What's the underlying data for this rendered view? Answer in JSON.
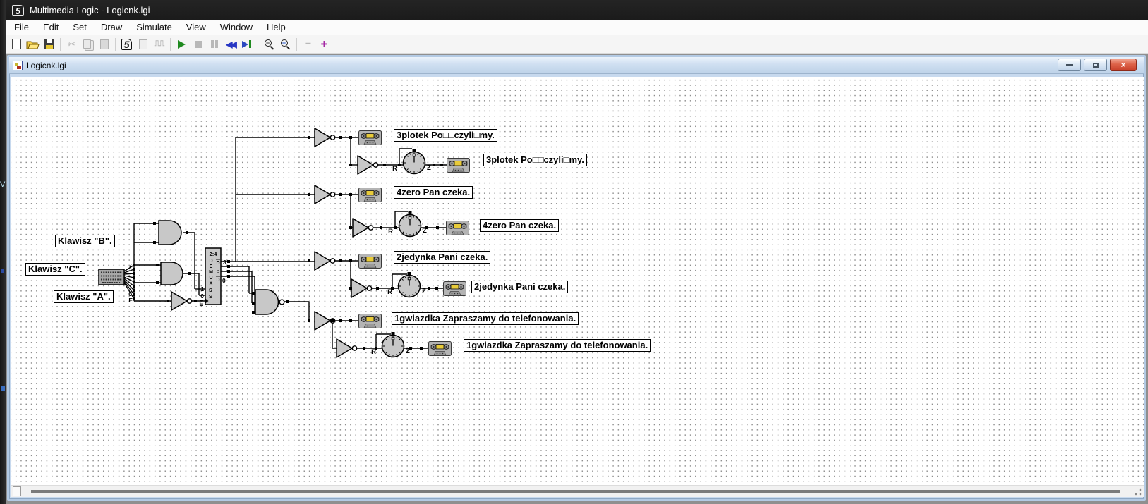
{
  "window": {
    "title": "Multimedia Logic - Logicnk.lgi"
  },
  "menu": {
    "items": [
      "File",
      "Edit",
      "Set",
      "Draw",
      "Simulate",
      "View",
      "Window",
      "Help"
    ]
  },
  "toolbar": {
    "icons": [
      "new",
      "open",
      "save",
      "cut",
      "copy",
      "paste",
      "logo",
      "report",
      "signals",
      "run",
      "stop",
      "pause",
      "rewind",
      "step-end",
      "zoom-out",
      "zoom-in",
      "remove",
      "add"
    ]
  },
  "child_window": {
    "title": "Logicnk.lgi"
  },
  "circuit": {
    "side_labels": [
      "Klawisz \"B\".",
      "Klawisz \"C\".",
      "Klawisz \"A\"."
    ],
    "keyboard_pins": {
      "top": "7",
      "bottom": "0",
      "enable": "E"
    },
    "demux": {
      "ratio": "2:4",
      "letters": [
        "D",
        "E",
        "M",
        "U",
        "X"
      ],
      "d": "D",
      "dots": ":",
      "out_top": "3",
      "out_bottom": "0",
      "s": "S",
      "sel_top": "1",
      "sel_bottom": "0",
      "enable": "E"
    },
    "timer": {
      "reset": "R",
      "out": "Z"
    },
    "rows": [
      {
        "label": "3plotek Po□□czyli□my."
      },
      {
        "label": "4zero Pan czeka."
      },
      {
        "label": "2jedynka Pani czeka."
      },
      {
        "label": "1gwiazdka Zapraszamy do telefonowania."
      }
    ]
  }
}
